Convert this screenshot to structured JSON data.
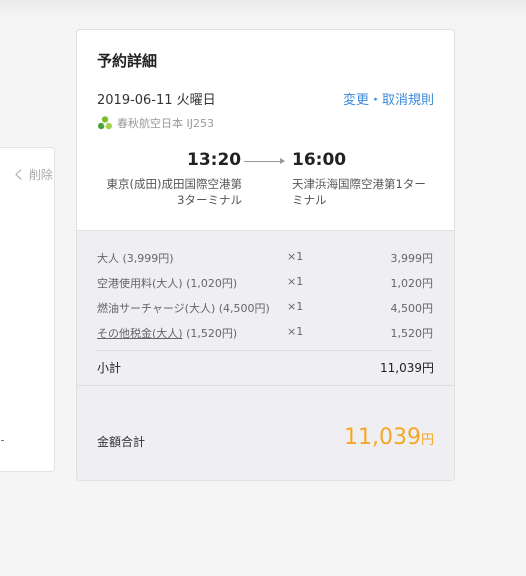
{
  "left_panel": {
    "delete_label": "く 削除"
  },
  "card": {
    "title": "予約詳細",
    "date": "2019-06-11 火曜日",
    "change_link": "変更・取消規則",
    "airline": "春秋航空日本 IJ253",
    "departure": {
      "time": "13:20",
      "airport_line1": "東京(成田)成田国際空港第",
      "airport_line2": "3ターミナル"
    },
    "arrival": {
      "time": "16:00",
      "airport_line1": "天津浜海国際空港第1ター",
      "airport_line2": "ミナル"
    }
  },
  "fees": [
    {
      "name": "大人 (3,999円)",
      "qty": "×1",
      "amount": "3,999円"
    },
    {
      "name": "空港使用料(大人) (1,020円)",
      "qty": "×1",
      "amount": "1,020円"
    },
    {
      "name": "燃油サーチャージ(大人) (4,500円)",
      "qty": "×1",
      "amount": "4,500円"
    },
    {
      "name": "その他税金(大人)",
      "name_suffix": " (1,520円)",
      "qty": "×1",
      "amount": "1,520円"
    }
  ],
  "subtotal": {
    "label": "小計",
    "value": "11,039円"
  },
  "total": {
    "label": "金額合計",
    "value": "11,039",
    "unit": "円"
  },
  "colors": {
    "link": "#3b8ad9",
    "total": "#f5a623",
    "brand_green": "#7cbf2c"
  }
}
